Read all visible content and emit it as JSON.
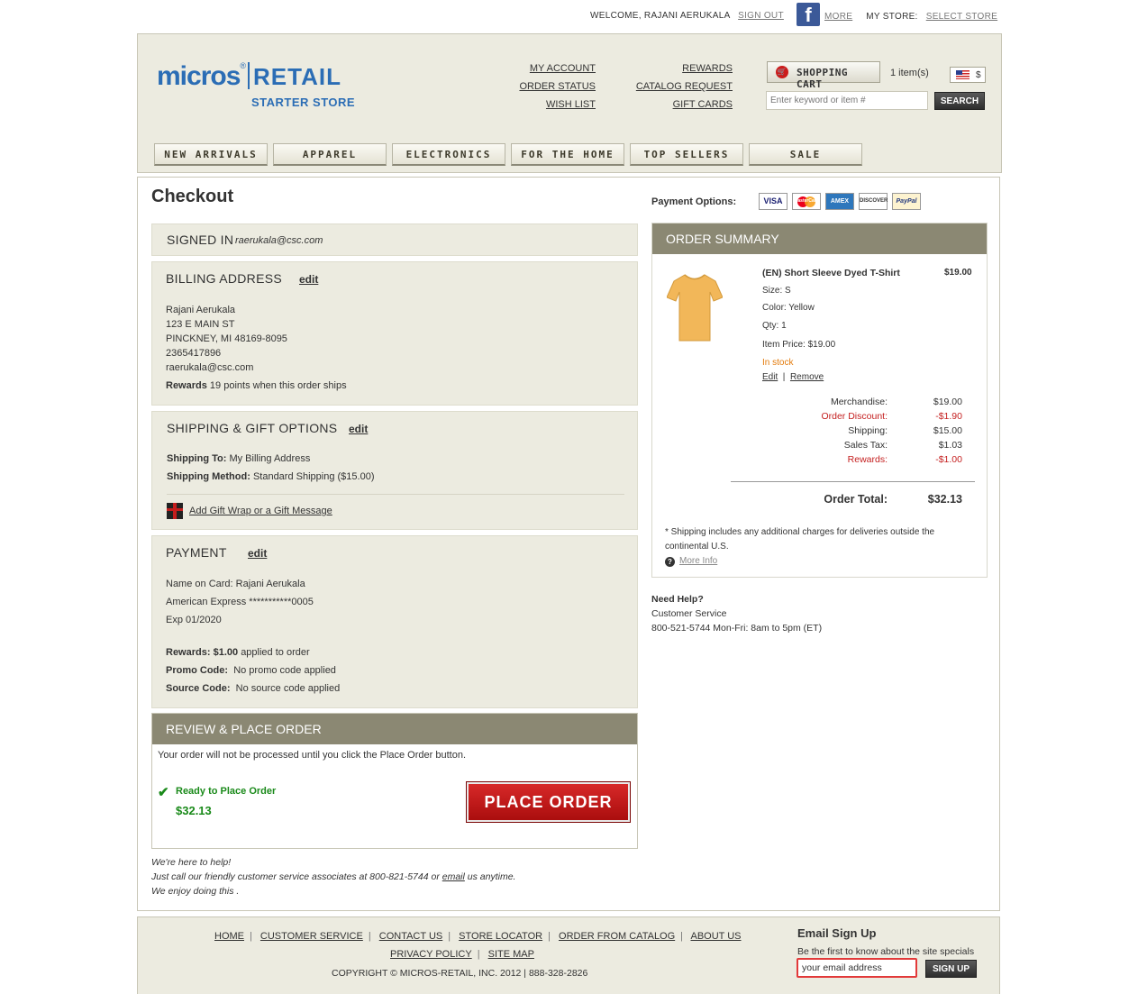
{
  "util": {
    "welcome": "WELCOME, RAJANI AERUKALA",
    "sign_out": "SIGN OUT",
    "more": "MORE",
    "my_store_label": "MY STORE:",
    "select_store": "SELECT STORE",
    "facebook_glyph": "f"
  },
  "header": {
    "logo_main": "micros",
    "logo_reg": "®",
    "logo_retail": "RETAIL",
    "logo_sub": "STARTER STORE",
    "links_col1": [
      "MY ACCOUNT",
      "ORDER STATUS",
      "WISH LIST"
    ],
    "links_col2": [
      "REWARDS",
      "CATALOG REQUEST",
      "GIFT CARDS"
    ],
    "cart_label": "SHOPPING CART",
    "cart_items": "1 item(s)",
    "currency": "$",
    "search_placeholder": "Enter keyword or item #",
    "search_button": "SEARCH"
  },
  "nav": [
    "NEW ARRIVALS",
    "APPAREL",
    "ELECTRONICS",
    "FOR THE HOME",
    "TOP SELLERS",
    "SALE"
  ],
  "checkout": {
    "title": "Checkout",
    "signed_in": {
      "label": "SIGNED IN",
      "email": "raerukala@csc.com"
    },
    "billing": {
      "label": "BILLING ADDRESS",
      "edit": "edit",
      "name": "Rajani Aerukala",
      "street": "123 E MAIN ST",
      "city": "PINCKNEY, MI 48169-8095",
      "phone": "2365417896",
      "email": "raerukala@csc.com",
      "rewards_label": "Rewards",
      "rewards_text": "19 points when this order ships"
    },
    "shipping": {
      "label": "SHIPPING & GIFT OPTIONS",
      "edit": "edit",
      "to_label": "Shipping To:",
      "to_value": "My Billing Address",
      "method_label": "Shipping Method:",
      "method_value": "Standard Shipping ($15.00)",
      "gift_link": "Add Gift Wrap or a Gift Message"
    },
    "payment": {
      "label": "PAYMENT",
      "edit": "edit",
      "name_on_card": "Name on Card: Rajani Aerukala",
      "card": "American Express ***********0005",
      "exp": "Exp 01/2020",
      "rewards_label": "Rewards:",
      "rewards_amount": "$1.00",
      "rewards_text": "applied to order",
      "promo_label": "Promo Code:",
      "promo_value": "No promo code applied",
      "source_label": "Source Code:",
      "source_value": "No source code applied"
    },
    "review": {
      "label": "REVIEW & PLACE ORDER",
      "note": "Your order will not be processed until you click the Place Order button.",
      "ready": "Ready to Place Order",
      "total": "$32.13",
      "button": "PLACE ORDER"
    },
    "help": {
      "line1": "We're here to help!",
      "line2_pre": "Just call our friendly customer service associates at 800-821-5744 or",
      "line2_link": "email",
      "line2_post": "us anytime.",
      "line3": "We enjoy doing this ."
    }
  },
  "payment_options": {
    "label": "Payment Options:",
    "cards": [
      "VISA",
      "MasterCard",
      "AMEX",
      "DISCOVER",
      "PayPal"
    ]
  },
  "summary": {
    "label": "ORDER SUMMARY",
    "product": {
      "name": "(EN) Short Sleeve Dyed T-Shirt",
      "price": "$19.00",
      "size": "Size: S",
      "color": "Color: Yellow",
      "qty": "Qty: 1",
      "item_price": "Item Price: $19.00",
      "stock": "In stock",
      "edit": "Edit",
      "remove": "Remove"
    },
    "totals": [
      {
        "label": "Merchandise:",
        "value": "$19.00",
        "red": false
      },
      {
        "label": "Order Discount:",
        "value": "-$1.90",
        "red": true
      },
      {
        "label": "Shipping:",
        "value": "$15.00",
        "red": false
      },
      {
        "label": "Sales Tax:",
        "value": "$1.03",
        "red": false
      },
      {
        "label": "Rewards:",
        "value": "-$1.00",
        "red": true
      }
    ],
    "order_total_label": "Order Total:",
    "order_total_value": "$32.13",
    "note": "* Shipping includes any additional charges for deliveries outside the",
    "note2": "continental U.S.",
    "more_info": "More Info"
  },
  "need_help": {
    "title": "Need Help?",
    "line1": "Customer Service",
    "line2": "800-521-5744 Mon-Fri: 8am to 5pm (ET)"
  },
  "footer": {
    "links": [
      "HOME",
      "CUSTOMER SERVICE",
      "CONTACT US",
      "STORE LOCATOR",
      "ORDER FROM CATALOG",
      "ABOUT US"
    ],
    "links2": [
      "PRIVACY POLICY",
      "SITE MAP"
    ],
    "copyright": "COPYRIGHT © MICROS-RETAIL, INC. 2012 | 888-328-2826",
    "email_title": "Email Sign Up",
    "email_sub": "Be the first to know about the site specials",
    "email_placeholder": "your email address",
    "email_button": "SIGN UP"
  },
  "colors": {
    "brand_blue": "#2b6db5",
    "header_bg": "#ecebe0",
    "section_head": "#8b8873",
    "place_order_red": "#c41e1e",
    "ready_green": "#1a8a1a"
  }
}
